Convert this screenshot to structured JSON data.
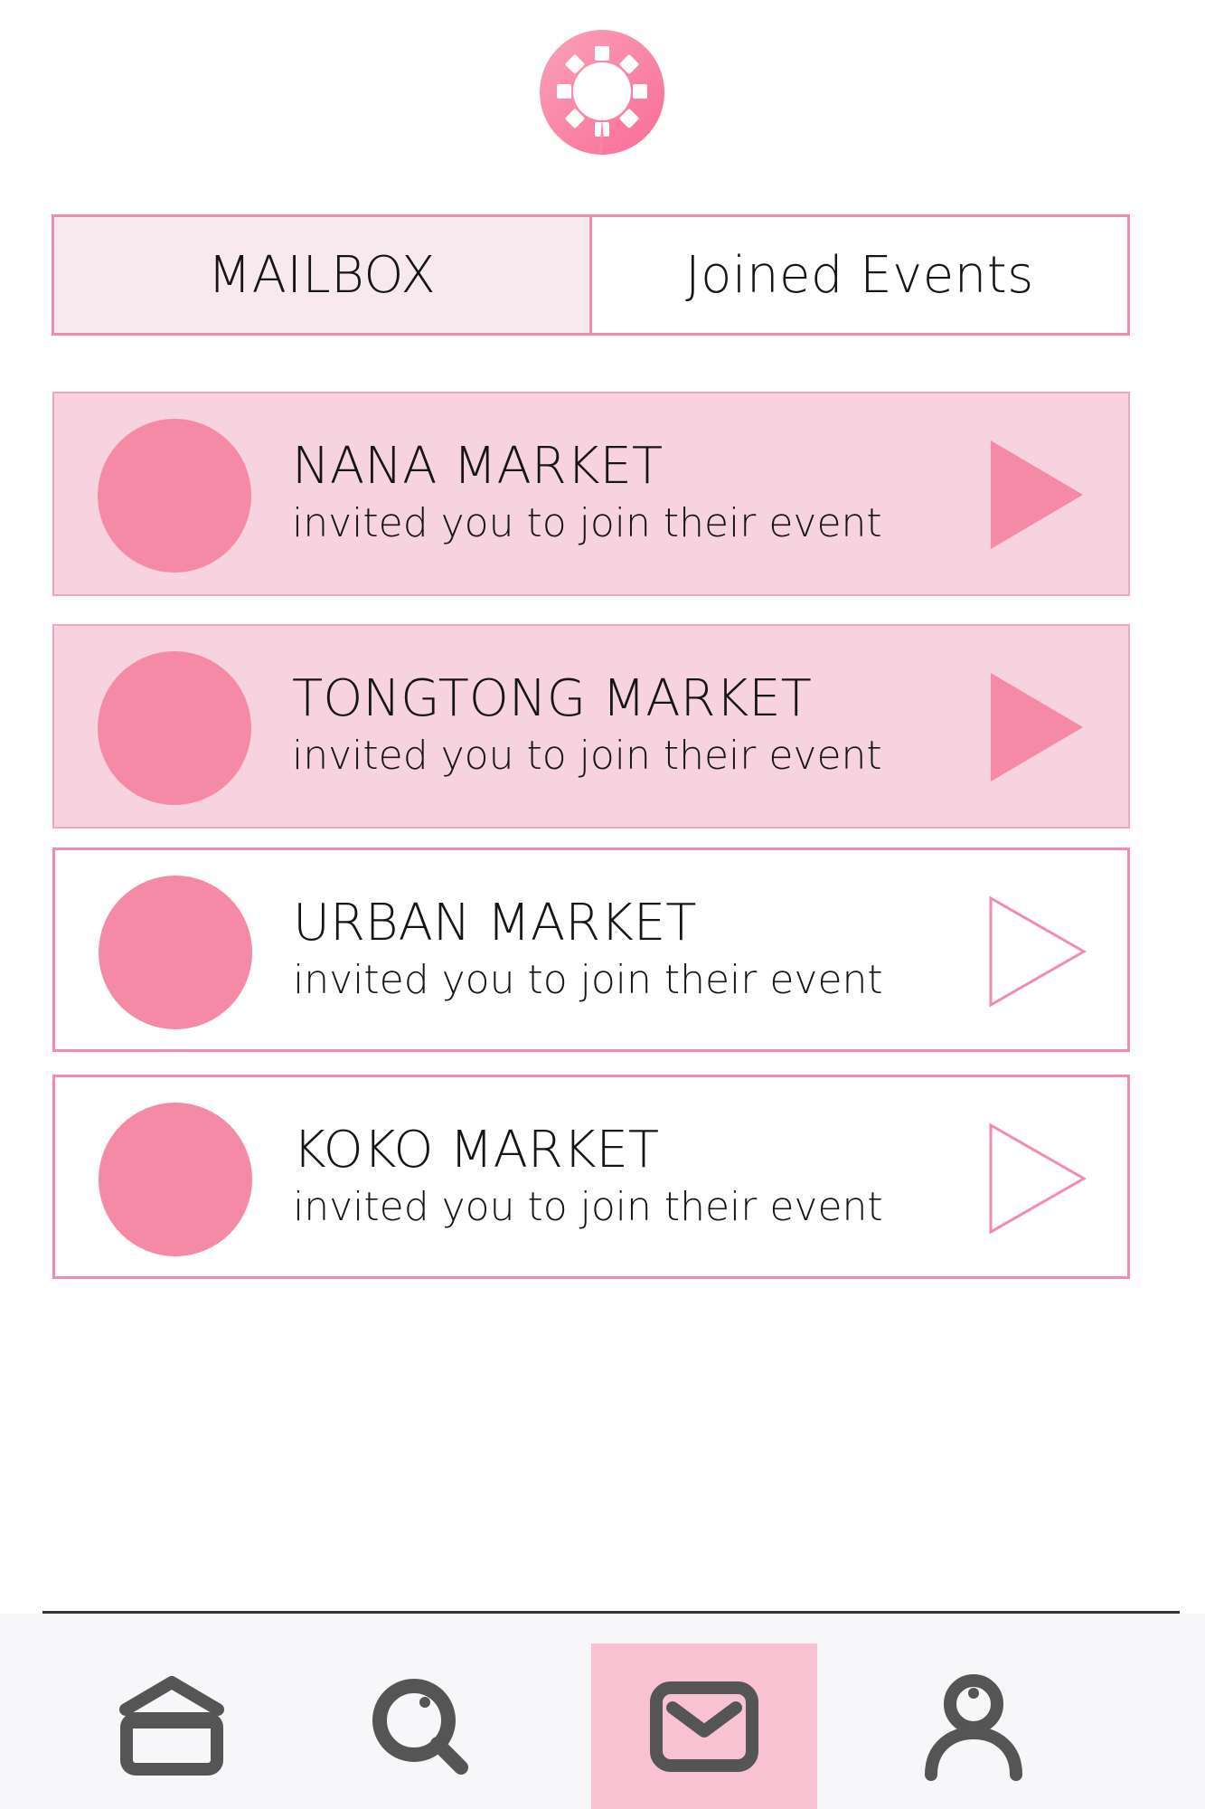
{
  "tabs": [
    {
      "label": "MAILBOX",
      "active": true
    },
    {
      "label": "Joined Events",
      "active": false
    }
  ],
  "invitations": [
    {
      "name": "NANA MARKET",
      "message": "invited you to join their event",
      "unread": true
    },
    {
      "name": "TONGTONG MARKET",
      "message": "invited you to join their event",
      "unread": true
    },
    {
      "name": "URBAN MARKET",
      "message": "invited you to join their event",
      "unread": false
    },
    {
      "name": "KOKO MARKET",
      "message": "invited you to join their event",
      "unread": false
    }
  ],
  "nav": {
    "items": [
      {
        "icon": "home-icon",
        "active": false
      },
      {
        "icon": "search-icon",
        "active": false
      },
      {
        "icon": "mail-icon",
        "active": true
      },
      {
        "icon": "profile-icon",
        "active": false
      }
    ]
  },
  "colors": {
    "accent": "#f38bab",
    "avatar": "#f58aa7",
    "unread_bg": "#f7d2df",
    "active_tab_bg": "#f8e9ef",
    "nav_active_bg": "#f8c2d3",
    "nav_icon": "#555555"
  }
}
